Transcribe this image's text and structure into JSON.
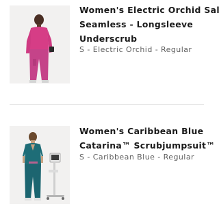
{
  "items": [
    {
      "title_lines": [
        "Women's Electric Orchid Salta",
        "Seamless - Longsleeve",
        "Underscrub"
      ],
      "variant": "S - Electric Orchid - Regular",
      "image_icon": "product-photo-longsleeve-underscrub",
      "color": "#d23f8a"
    },
    {
      "title_lines": [
        "Women's Caribbean Blue",
        "Catarina™ Scrubjumpsuit™"
      ],
      "variant": "S - Caribbean Blue - Regular",
      "image_icon": "product-photo-scrubjumpsuit",
      "color": "#1f6f78"
    }
  ]
}
